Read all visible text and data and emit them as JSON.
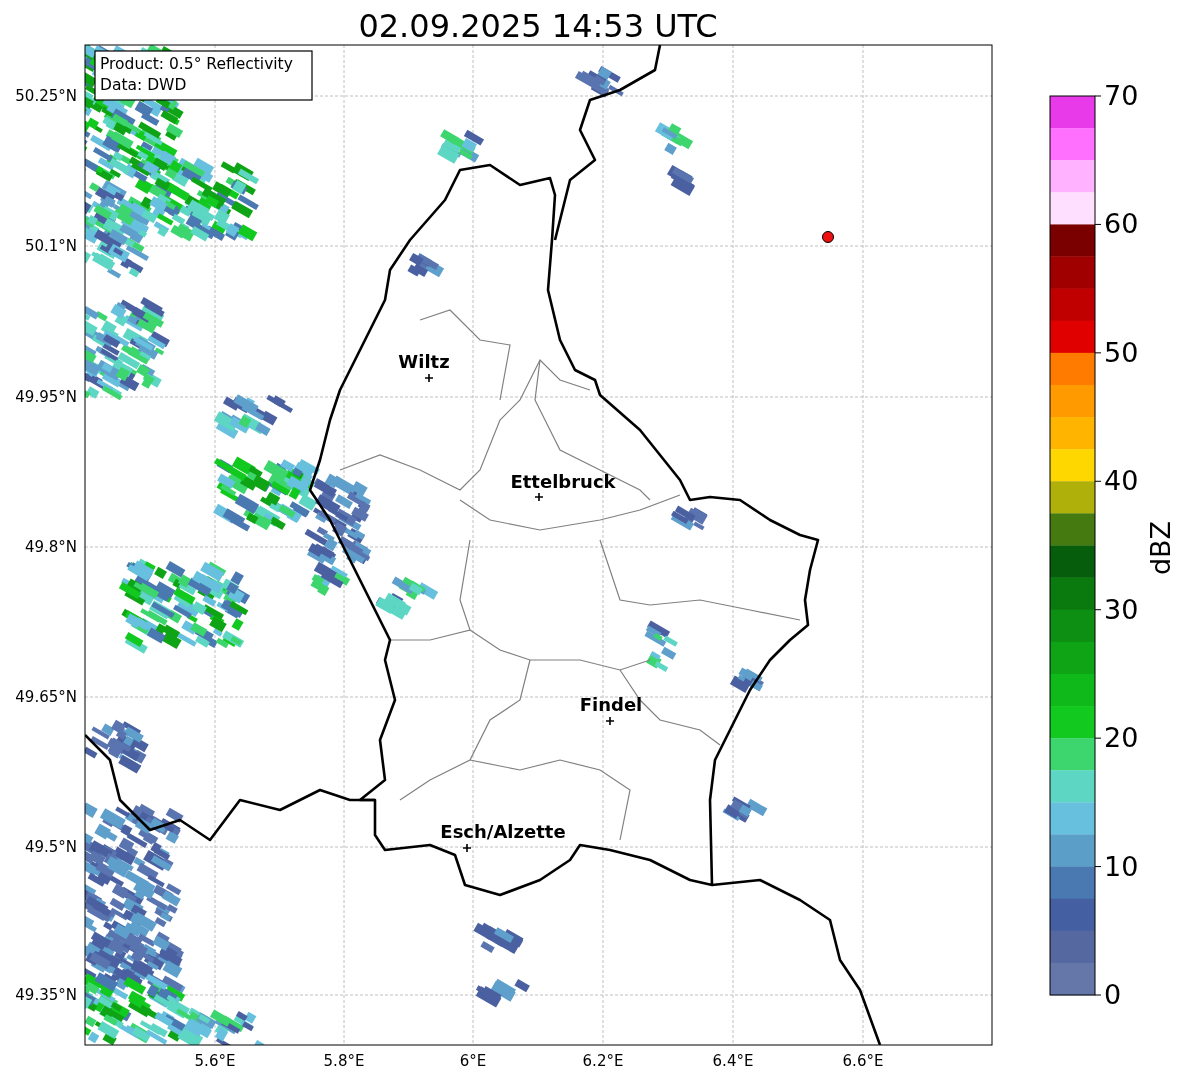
{
  "title": "02.09.2025 14:53 UTC",
  "info_box": {
    "lines": [
      "Product: 0.5° Reflectivity",
      "Data: DWD"
    ]
  },
  "cities": [
    {
      "name": "Wiltz"
    },
    {
      "name": "Ettelbruck"
    },
    {
      "name": "Findel"
    },
    {
      "name": "Esch/Alzette"
    }
  ],
  "x_ticks": [
    "5.6°E",
    "5.8°E",
    "6°E",
    "6.2°E",
    "6.4°E",
    "6.6°E"
  ],
  "y_ticks": [
    "50.25°N",
    "50.1°N",
    "49.95°N",
    "49.8°N",
    "49.65°N",
    "49.5°N",
    "49.35°N"
  ],
  "colorbar": {
    "label": "dBZ",
    "ticks": [
      "70",
      "60",
      "50",
      "40",
      "30",
      "20",
      "10",
      "0"
    ],
    "segments": [
      {
        "color": "#e83ae8"
      },
      {
        "color": "#ff70ff"
      },
      {
        "color": "#ffb2ff"
      },
      {
        "color": "#ffdfff"
      },
      {
        "color": "#7a0000"
      },
      {
        "color": "#a00000"
      },
      {
        "color": "#c00000"
      },
      {
        "color": "#e00000"
      },
      {
        "color": "#ff7b00"
      },
      {
        "color": "#ff9a00"
      },
      {
        "color": "#ffb400"
      },
      {
        "color": "#ffd700"
      },
      {
        "color": "#b0b00a"
      },
      {
        "color": "#447a10"
      },
      {
        "color": "#065e0c"
      },
      {
        "color": "#0a7a0f"
      },
      {
        "color": "#0c8f12"
      },
      {
        "color": "#0ea416"
      },
      {
        "color": "#10b91a"
      },
      {
        "color": "#12c91f"
      },
      {
        "color": "#3dd66e"
      },
      {
        "color": "#5dd6c4"
      },
      {
        "color": "#66c0de"
      },
      {
        "color": "#5b9fc9"
      },
      {
        "color": "#4a78b0"
      },
      {
        "color": "#4460a3"
      },
      {
        "color": "#55689f"
      },
      {
        "color": "#6577a8"
      }
    ]
  }
}
